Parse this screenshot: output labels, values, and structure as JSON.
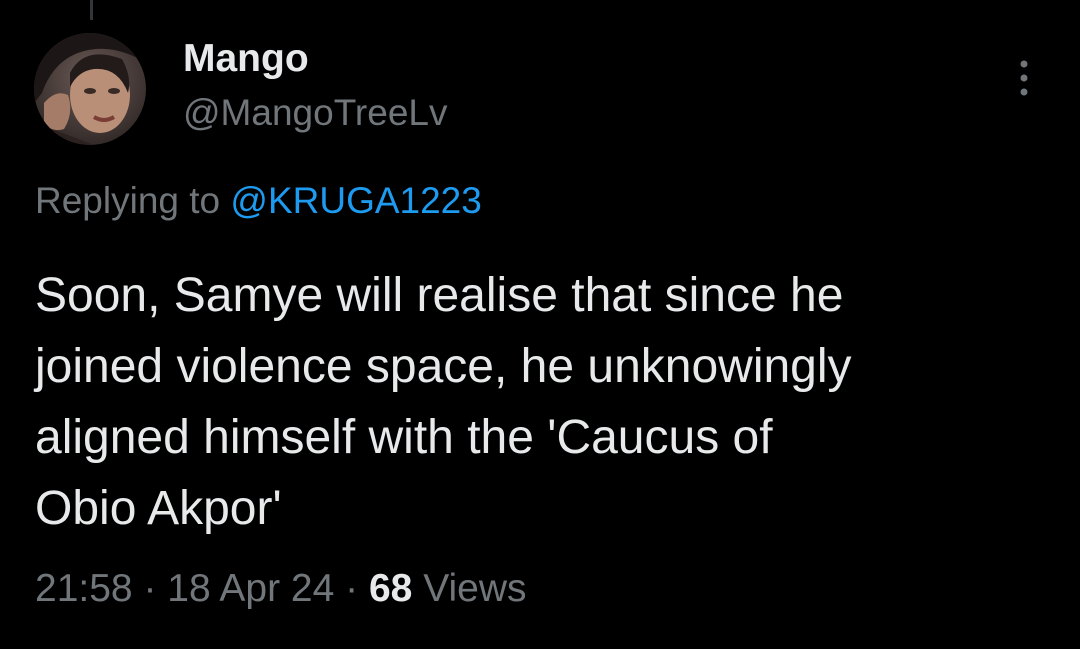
{
  "tweet": {
    "author_name": "Mango",
    "author_handle": "@MangoTreeLv",
    "replying_prefix": "Replying to",
    "replying_to": "@KRUGA1223",
    "text": "Soon, Samye will realise that since he\njoined violence space, he unknowingly\naligned himself with the 'Caucus of\nObio Akpor'",
    "time": "21:58",
    "separator": "·",
    "date": "18 Apr 24",
    "views_count": "68",
    "views_label": "Views"
  },
  "icons": {
    "more": "more-vertical-icon",
    "avatar": "profile-photo"
  },
  "colors": {
    "background": "#000000",
    "primary_text": "#e7e9ea",
    "secondary_text": "#71767b",
    "accent": "#1d9bf0"
  }
}
